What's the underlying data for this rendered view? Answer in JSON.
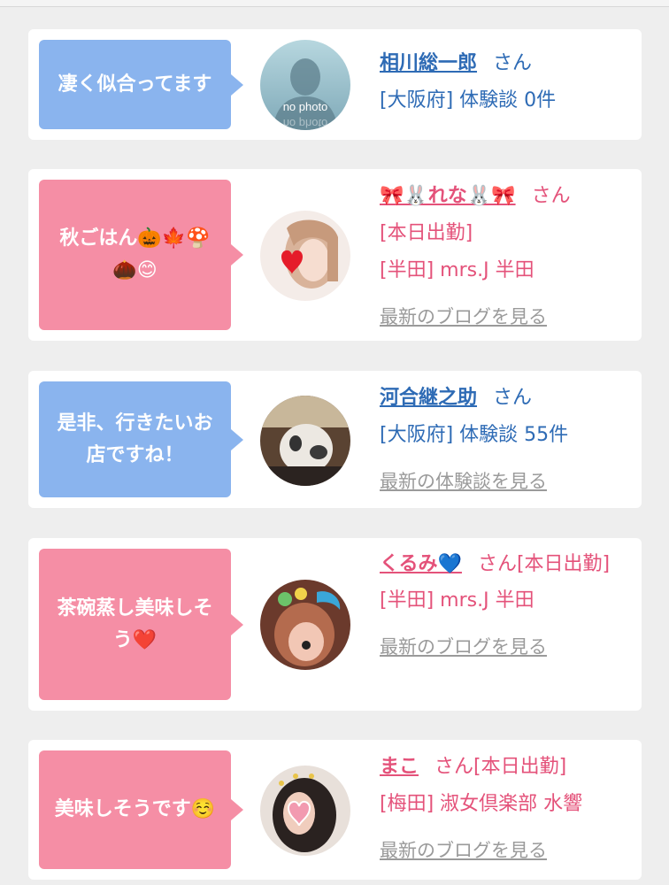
{
  "cards": [
    {
      "comment": "凄く似合ってます",
      "name": "相川総一郎",
      "san": "さん",
      "line2": "[大阪府] 体験談 0件",
      "avatar_text": "no photo",
      "avatar_text_mirror": "no photo"
    },
    {
      "comment": "秋ごはん🎃🍁🍄🌰😊",
      "name": "🎀🐰れな🐰🎀",
      "san": "さん",
      "line2": "[本日出勤]",
      "line3": "[半田] mrs.J 半田",
      "more": "最新のブログを見る"
    },
    {
      "comment": "是非、行きたいお店ですね！",
      "name": "河合継之助",
      "san": "さん",
      "line2": "[大阪府] 体験談 55件",
      "more": "最新の体験談を見る"
    },
    {
      "comment": "茶碗蒸し美味しそう❤️",
      "name": "くるみ💙",
      "san": "さん[本日出勤]",
      "line3": "[半田] mrs.J 半田",
      "more": "最新のブログを見る"
    },
    {
      "comment": "美味しそうです☺️",
      "name": "まこ",
      "san": "さん[本日出勤]",
      "line2": "[梅田] 淑女倶楽部 水響",
      "more": "最新のブログを見る"
    }
  ],
  "colors": {
    "blue_bubble": "#8ab4ee",
    "pink_bubble": "#f58ea5",
    "blue_text": "#2e6bb5",
    "pink_text": "#e4527a",
    "link_gray": "#9a9a9a"
  }
}
